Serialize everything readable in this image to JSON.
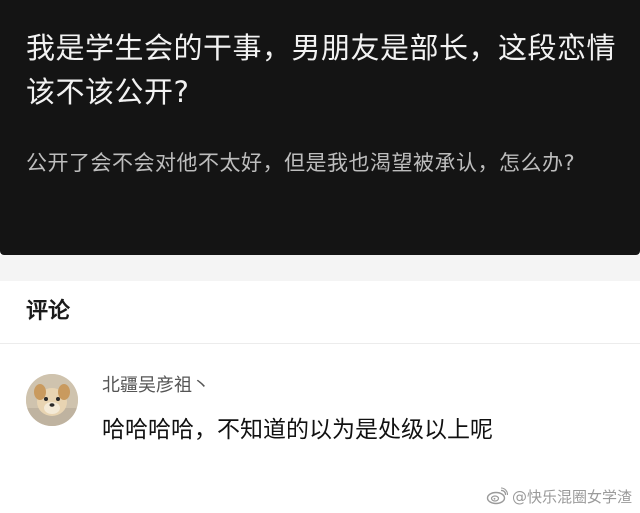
{
  "question": {
    "title": "我是学生会的干事，男朋友是部长，这段恋情该不该公开?",
    "description": "公开了会不会对他不太好，但是我也渴望被承认，怎么办?"
  },
  "comments": {
    "header": "评论",
    "items": [
      {
        "username": "北疆吴彦祖丶",
        "text": "哈哈哈哈，不知道的以为是处级以上呢"
      }
    ]
  },
  "watermark": {
    "text": "@快乐混圈女学渣"
  }
}
